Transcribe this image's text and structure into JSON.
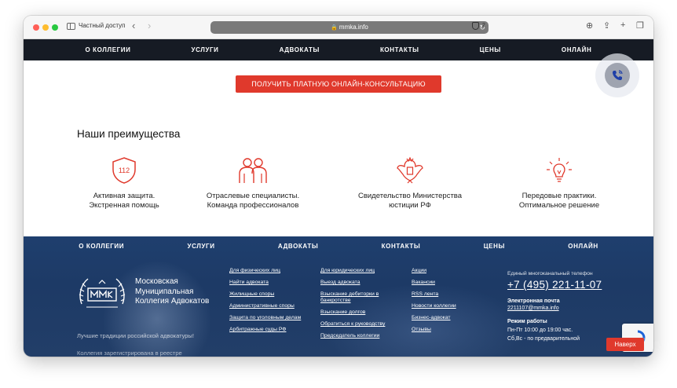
{
  "browser": {
    "private_label": "Частный доступ",
    "url": "mmka.info",
    "shield_count": "2"
  },
  "topnav": [
    "О КОЛЛЕГИИ",
    "УСЛУГИ",
    "АДВОКАТЫ",
    "КОНТАКТЫ",
    "ЦЕНЫ",
    "ОНЛАЙН"
  ],
  "cta_label": "ПОЛУЧИТЬ ПЛАТНУЮ ОНЛАЙН-КОНСУЛЬТАЦИЮ",
  "advantages": {
    "title": "Наши преимущества",
    "items": [
      {
        "line1": "Активная защита.",
        "line2": "Экстренная помощь",
        "icon": "shield-112-icon",
        "badge": "112"
      },
      {
        "line1": "Отраслевые специалисты.",
        "line2": "Команда профессионалов",
        "icon": "people-icon"
      },
      {
        "line1": "Свидетельство Министерства",
        "line2": "юстиции РФ",
        "icon": "eagle-emblem-icon"
      },
      {
        "line1": "Передовые практики.",
        "line2": "Оптимальное решение",
        "icon": "lightbulb-icon"
      }
    ]
  },
  "footer": {
    "nav": [
      "О КОЛЛЕГИИ",
      "УСЛУГИ",
      "АДВОКАТЫ",
      "КОНТАКТЫ",
      "ЦЕНЫ",
      "ОНЛАЙН"
    ],
    "logo_text": [
      "Московская",
      "Муниципальная",
      "Коллегия Адвокатов"
    ],
    "slogan": "Лучшие традиции российской адвокатуры!",
    "registered": "Коллегия зарегистрирована в реестре",
    "col1": [
      "Для физических лиц",
      "Найти адвоката",
      "Жилищные споры",
      "Административные споры",
      "Защита по уголовным делам",
      "Арбитражные суды РФ"
    ],
    "col2": [
      "Для юридических лиц",
      "Выезд адвоката",
      "Взыскание дебиторки в банкротстве",
      "Взыскание долгов",
      "Обратиться к руководству",
      "Председатель коллегии"
    ],
    "col3": [
      "Акции",
      "Вакансии",
      "RSS лента",
      "Новости коллегии",
      "Бизнес-адвокат",
      "Отзывы"
    ],
    "contact": {
      "phone_label": "Единый многоканальный телефон",
      "phone": "+7 (495) 221-11-07",
      "email_label": "Электронная почта",
      "email": "2211107@mmka.info",
      "hours_label": "Режим работы",
      "hours_line1": "Пн-Пт 10:00 до 19:00 час.",
      "hours_line2": "Сб,Вс - по предварительной"
    }
  },
  "up_button": "Наверх",
  "colors": {
    "accent": "#e0392c",
    "nav_bg": "#161b24",
    "footer_bg": "#1f3f6e"
  }
}
